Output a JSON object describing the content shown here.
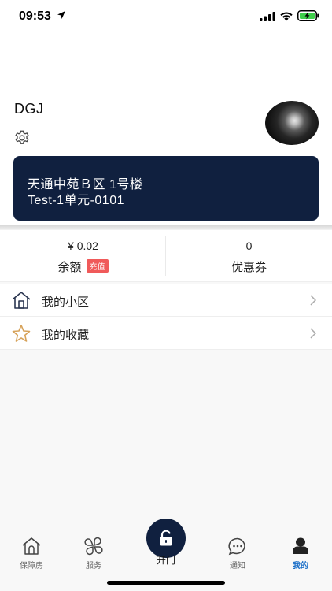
{
  "status_bar": {
    "time": "09:53",
    "icons": [
      "location-arrow-icon",
      "cellular-signal-icon",
      "wifi-icon",
      "battery-charging-icon"
    ]
  },
  "profile": {
    "username": "DGJ",
    "settings_icon": "gear-icon",
    "avatar_icon": "avatar"
  },
  "address_card": {
    "line1": "天通中苑Ｂ区 1号楼",
    "line2": "Test-1单元-0101",
    "background_color": "#10203f"
  },
  "stats": {
    "balance": {
      "value": "¥ 0.02",
      "label": "余额",
      "badge": "充值",
      "badge_color": "#f05a5a"
    },
    "coupons": {
      "value": "0",
      "label": "优惠券"
    }
  },
  "menu": {
    "items": [
      {
        "label": "我的小区",
        "icon": "house-icon"
      },
      {
        "label": "我的收藏",
        "icon": "star-icon"
      }
    ]
  },
  "tab_bar": {
    "tabs": [
      {
        "label": "保障房",
        "icon": "house-tab-icon",
        "active": false
      },
      {
        "label": "服务",
        "icon": "clover-grid-icon",
        "active": false
      },
      {
        "label": "开门",
        "icon": "unlock-icon",
        "active": false
      },
      {
        "label": "通知",
        "icon": "chat-bubble-icon",
        "active": false
      },
      {
        "label": "我的",
        "icon": "user-icon",
        "active": true
      }
    ],
    "active_color": "#1b6fc8",
    "open_door_color": "#10203f"
  }
}
